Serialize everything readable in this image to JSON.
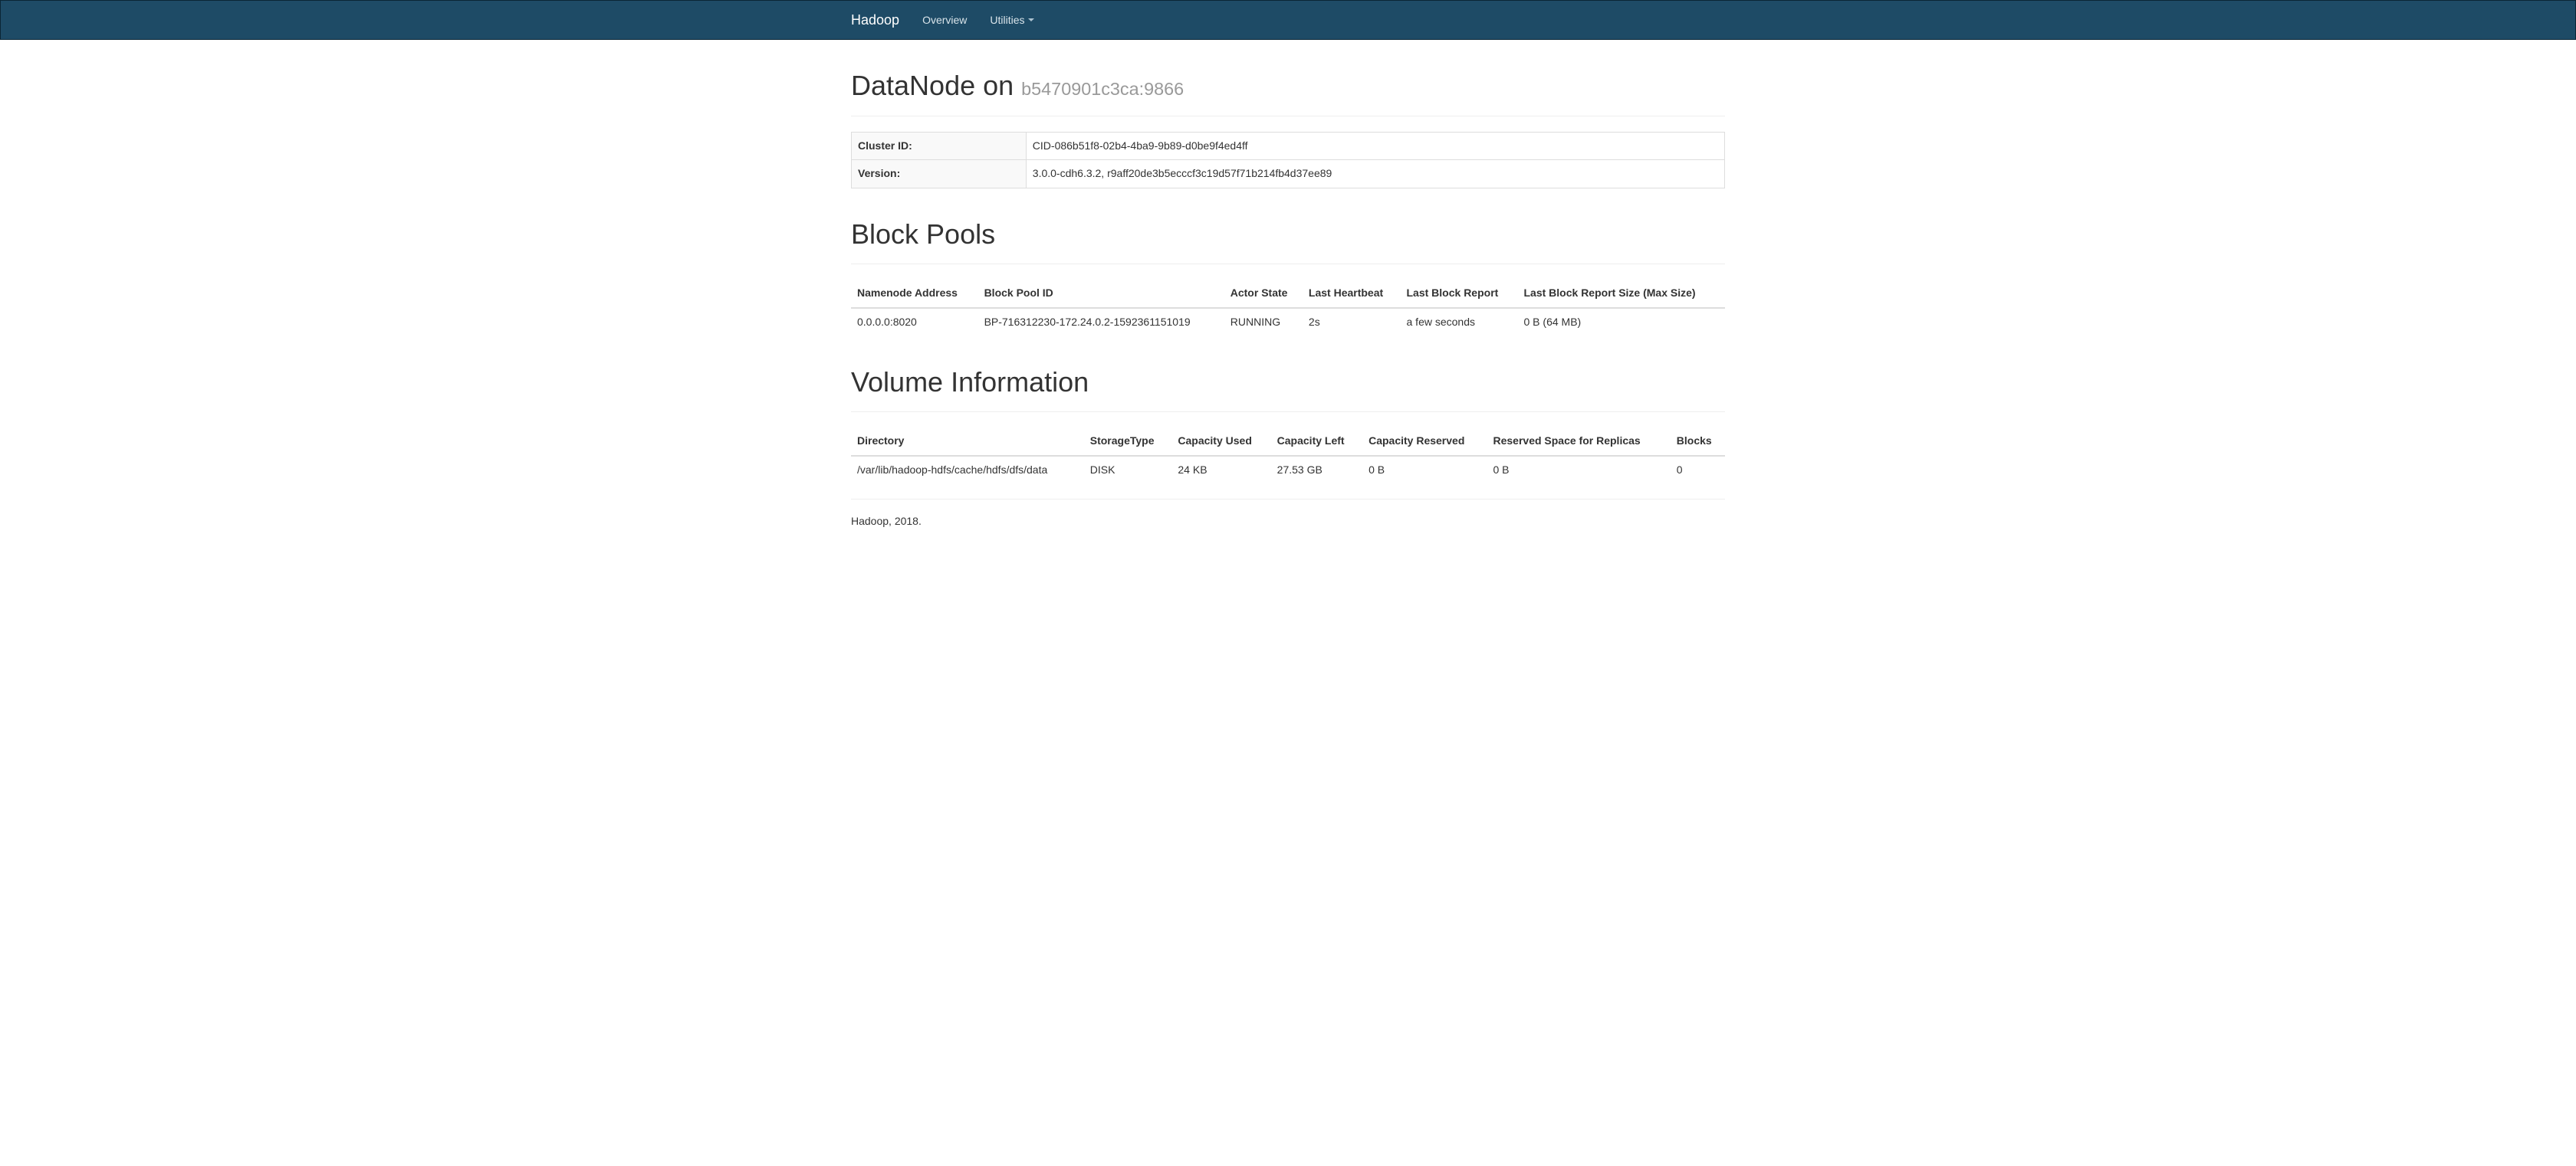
{
  "nav": {
    "brand": "Hadoop",
    "items": [
      "Overview",
      "Utilities"
    ]
  },
  "header": {
    "title_prefix": "DataNode on ",
    "host": "b5470901c3ca:9866"
  },
  "info_table": {
    "rows": [
      {
        "label": "Cluster ID:",
        "value": "CID-086b51f8-02b4-4ba9-9b89-d0be9f4ed4ff"
      },
      {
        "label": "Version:",
        "value": "3.0.0-cdh6.3.2, r9aff20de3b5ecccf3c19d57f71b214fb4d37ee89"
      }
    ]
  },
  "block_pools": {
    "heading": "Block Pools",
    "headers": [
      "Namenode Address",
      "Block Pool ID",
      "Actor State",
      "Last Heartbeat",
      "Last Block Report",
      "Last Block Report Size (Max Size)"
    ],
    "rows": [
      {
        "namenode": "0.0.0.0:8020",
        "bpid": "BP-716312230-172.24.0.2-1592361151019",
        "state": "RUNNING",
        "heartbeat": "2s",
        "last_report": "a few seconds",
        "report_size": "0 B (64 MB)"
      }
    ]
  },
  "volume_info": {
    "heading": "Volume Information",
    "headers": [
      "Directory",
      "StorageType",
      "Capacity Used",
      "Capacity Left",
      "Capacity Reserved",
      "Reserved Space for Replicas",
      "Blocks"
    ],
    "rows": [
      {
        "dir": "/var/lib/hadoop-hdfs/cache/hdfs/dfs/data",
        "type": "DISK",
        "used": "24 KB",
        "left": "27.53 GB",
        "reserved": "0 B",
        "replicas": "0 B",
        "blocks": "0"
      }
    ]
  },
  "footer": "Hadoop, 2018."
}
